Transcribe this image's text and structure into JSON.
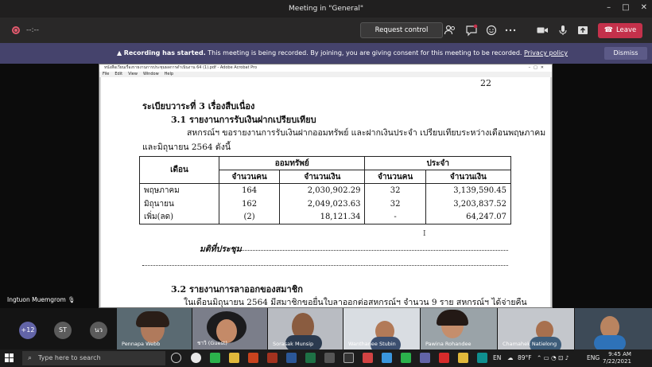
{
  "window": {
    "title": "Meeting in \"General\"",
    "controls": [
      "–",
      "□",
      "✕"
    ]
  },
  "toolbar": {
    "timer": "--:--",
    "request_control_label": "Request control",
    "leave_label": "Leave"
  },
  "banner": {
    "bold": "Recording has started.",
    "text": " This meeting is being recorded. By joining, you are giving consent for this meeting to be recorded.",
    "link": "Privacy policy",
    "dismiss_label": "Dismiss"
  },
  "acrobat": {
    "title": "หนังสือเวียนเรื่องรายงานการประชุมผลการดำเนินงาน 64 (1).pdf - Adobe Acrobat Pro",
    "menu": [
      "File",
      "Edit",
      "View",
      "Window",
      "Help"
    ]
  },
  "document": {
    "page_number": "22",
    "heading1": "ระเบียบวาระที่ 3  เรื่องสืบเนื่อง",
    "heading2": "3.1 รายงานการรับเงินฝากเปรียบเทียบ",
    "para1": "สหกรณ์ฯ ขอรายงานการรับเงินฝากออมทรัพย์ และฝากเงินประจำ เปรียบเทียบระหว่างเดือนพฤษภาคม",
    "para2": "และมิถุนายน 2564 ดังนี้",
    "table": {
      "col_month": "เดือน",
      "group_savings": "ออมทรัพย์",
      "group_fixed": "ประจำ",
      "sub_count": "จำนวนคน",
      "sub_amount": "จำนวนเงิน",
      "rows": [
        {
          "month": "พฤษภาคม",
          "s_count": "164",
          "s_amount": "2,030,902.29",
          "f_count": "32",
          "f_amount": "3,139,590.45"
        },
        {
          "month": "มิถุนายน",
          "s_count": "162",
          "s_amount": "2,049,023.63",
          "f_count": "32",
          "f_amount": "3,203,837.52"
        },
        {
          "month": "เพิ่ม(ลด)",
          "s_count": "(2)",
          "s_amount": "18,121.34",
          "f_count": "-",
          "f_amount": "64,247.07"
        }
      ]
    },
    "resolution_label": "มติที่ประชุม",
    "heading3": "3.2 รายงานการลาออกของสมาชิก",
    "para3": "ในเดือนมิถุนายน 2564 มีสมาชิกขอยื่นใบลาออกต่อสหกรณ์ฯ จำนวน 9 ราย สหกรณ์ฯ ได้จ่ายคืน"
  },
  "presenter": "Ingtuon Muemgrom",
  "participants": {
    "overflow": "+12",
    "initials": [
      "ST",
      "นว"
    ],
    "tiles": [
      "Pennapa Webb",
      "ชาวิ (Guest)",
      "Sorasak Munsip",
      "Wanthanee Stubin",
      "Pawina Rohandee",
      "Chamahek Natielong",
      ""
    ]
  },
  "taskbar": {
    "search_placeholder": "Type here to search",
    "weather": "89°F",
    "lang1": "EN",
    "lang2": "ENG",
    "time": "9:45 AM",
    "date": "7/22/2021"
  },
  "colors": {
    "banner": "#45436c",
    "leave": "#c4314b",
    "toolbar": "#292828"
  }
}
